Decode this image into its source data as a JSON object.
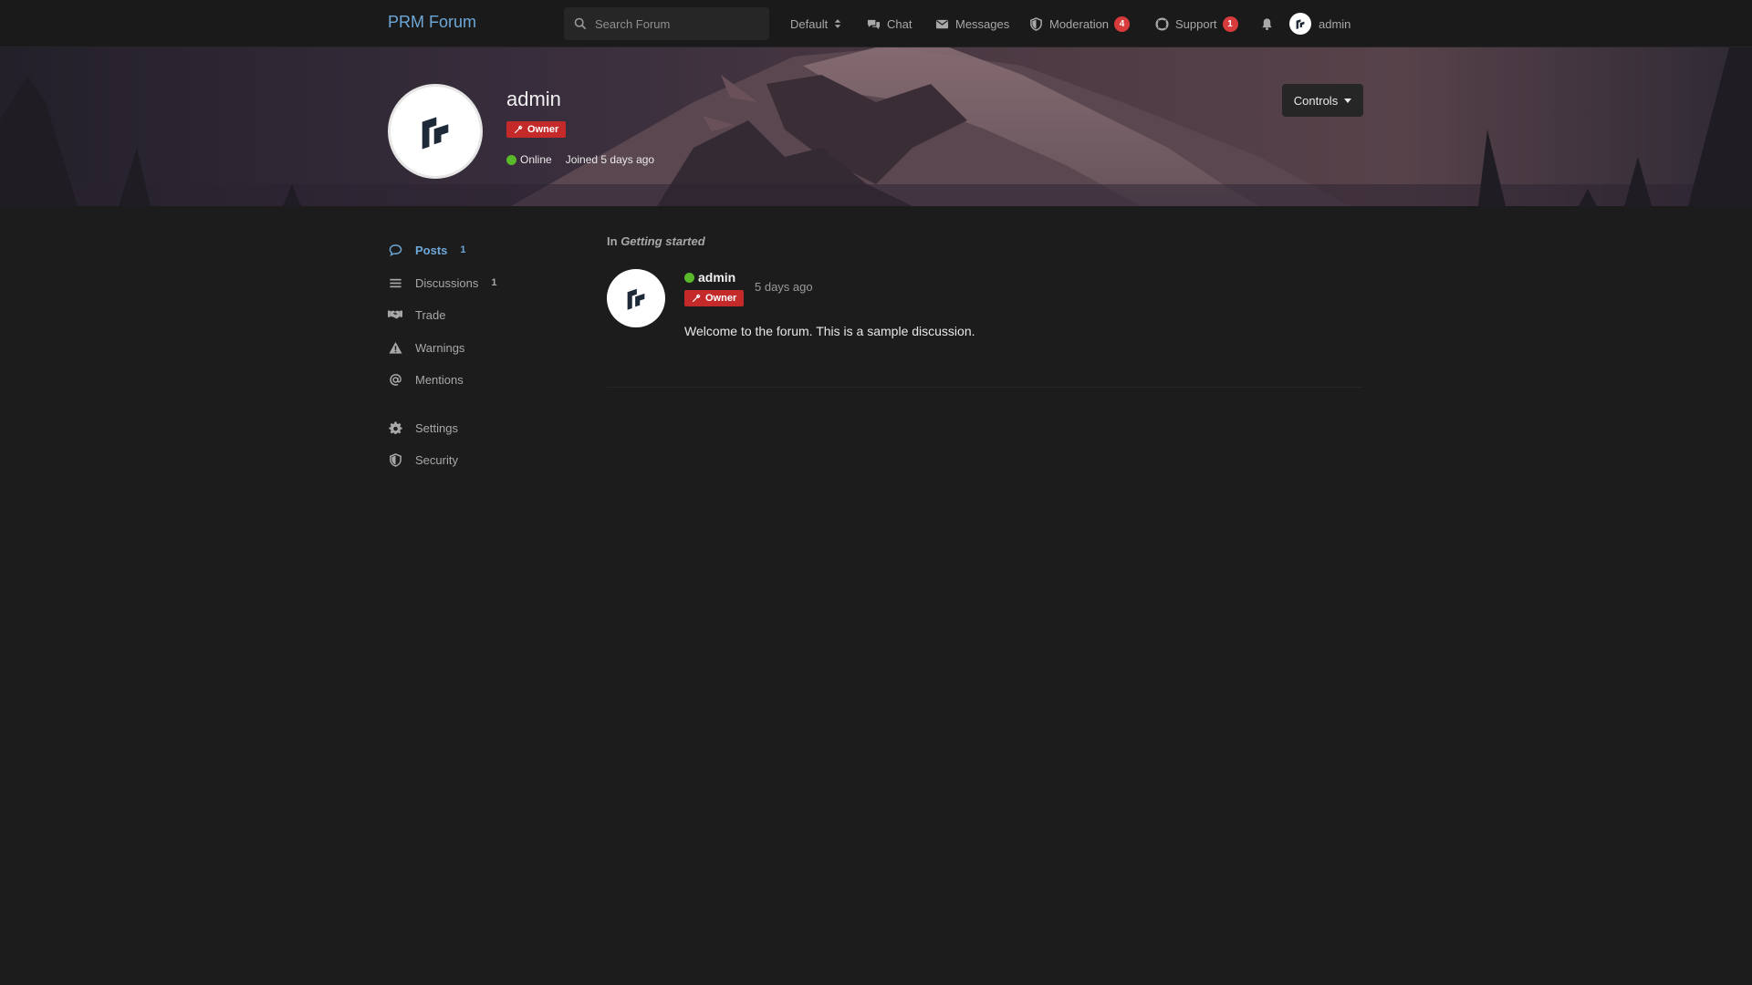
{
  "header": {
    "brand": "PRM Forum",
    "search_placeholder": "Search Forum",
    "theme_label": "Default",
    "chat_label": "Chat",
    "messages_label": "Messages",
    "moderation_label": "Moderation",
    "moderation_count": "4",
    "support_label": "Support",
    "support_count": "1",
    "user_label": "admin"
  },
  "profile": {
    "username": "admin",
    "group_badge": "Owner",
    "status": "Online",
    "joined": "Joined 5 days ago",
    "controls_label": "Controls"
  },
  "sidebar": {
    "items": [
      {
        "label": "Posts",
        "count": "1",
        "icon": "comment-icon"
      },
      {
        "label": "Discussions",
        "count": "1",
        "icon": "list-icon"
      },
      {
        "label": "Trade",
        "icon": "handshake-icon"
      },
      {
        "label": "Warnings",
        "icon": "warning-icon"
      },
      {
        "label": "Mentions",
        "icon": "at-icon"
      },
      {
        "label": "Settings",
        "icon": "gear-icon"
      },
      {
        "label": "Security",
        "icon": "shield-icon"
      }
    ]
  },
  "post": {
    "context_prefix": "In",
    "discussion_title": "Getting started",
    "author": "admin",
    "badge": "Owner",
    "time": "5 days ago",
    "body": "Welcome to the forum. This is a sample discussion."
  },
  "colors": {
    "background": "#1c1c1c",
    "accent": "#6ea8d8",
    "owner_badge": "#c42a2a",
    "online": "#5ab82b",
    "notification_badge": "#d83b3b"
  }
}
